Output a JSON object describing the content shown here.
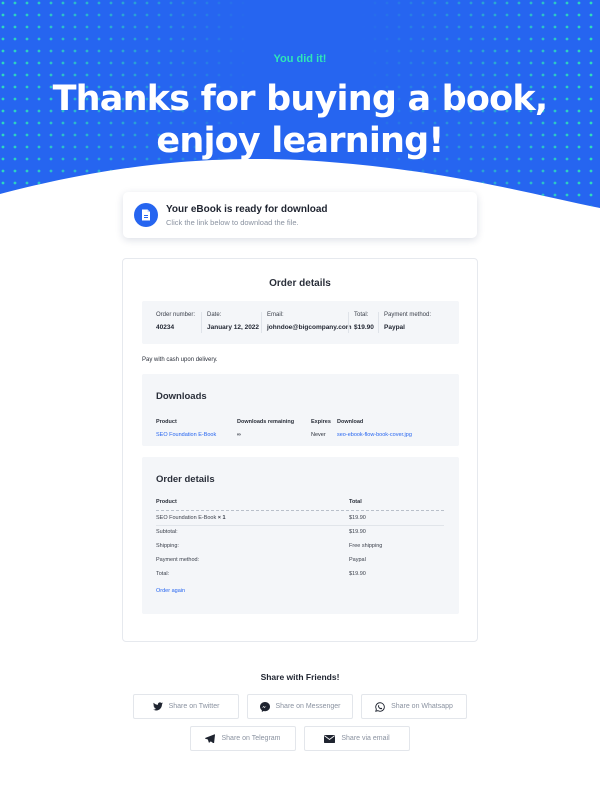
{
  "hero": {
    "tag": "You did it!",
    "title_line1": "Thanks for buying a book,",
    "title_line2": "enjoy learning!",
    "bg_color": "#2665f0",
    "dot_color": "#2ee6b8"
  },
  "ready_card": {
    "icon": "document-icon",
    "title": "Your eBook is ready for download",
    "subtitle": "Click the link below to download the file."
  },
  "order_panel": {
    "title": "Order details",
    "summary": {
      "order_number_label": "Order number:",
      "order_number": "40234",
      "date_label": "Date:",
      "date": "January 12, 2022",
      "email_label": "Email:",
      "email": "johndoe@bigcompany.com",
      "total_label": "Total:",
      "total": "$19.90",
      "payment_label": "Payment method:",
      "payment": "Paypal"
    },
    "cash_note": "Pay with cash upon delivery.",
    "downloads": {
      "title": "Downloads",
      "headers": {
        "product": "Product",
        "remaining": "Downloads remaining",
        "expires": "Expires",
        "download": "Download"
      },
      "row": {
        "product": "SEO Foundation E-Book",
        "remaining": "∞",
        "expires": "Never",
        "download": "seo-ebook-flow-book-cover.jpg"
      }
    },
    "details": {
      "title": "Order details",
      "headers": {
        "product": "Product",
        "total": "Total"
      },
      "item": {
        "name": "SEO Foundation E-Book",
        "qty": "× 1",
        "total": "$19.90"
      },
      "subtotal": {
        "label": "Subtotal:",
        "value": "$19.90"
      },
      "shipping": {
        "label": "Shipping:",
        "value": "Free shipping"
      },
      "payment": {
        "label": "Payment method:",
        "value": "Paypal"
      },
      "total": {
        "label": "Total:",
        "value": "$19.90"
      },
      "order_again": "Order again"
    }
  },
  "share": {
    "title": "Share with Friends!",
    "buttons": {
      "twitter": {
        "label": "Share on Twitter",
        "icon": "twitter-icon"
      },
      "messenger": {
        "label": "Share on Messenger",
        "icon": "messenger-icon"
      },
      "whatsapp": {
        "label": "Share on Whatsapp",
        "icon": "whatsapp-icon"
      },
      "telegram": {
        "label": "Share on Telegram",
        "icon": "telegram-icon"
      },
      "email": {
        "label": "Share via email",
        "icon": "email-icon"
      }
    }
  }
}
